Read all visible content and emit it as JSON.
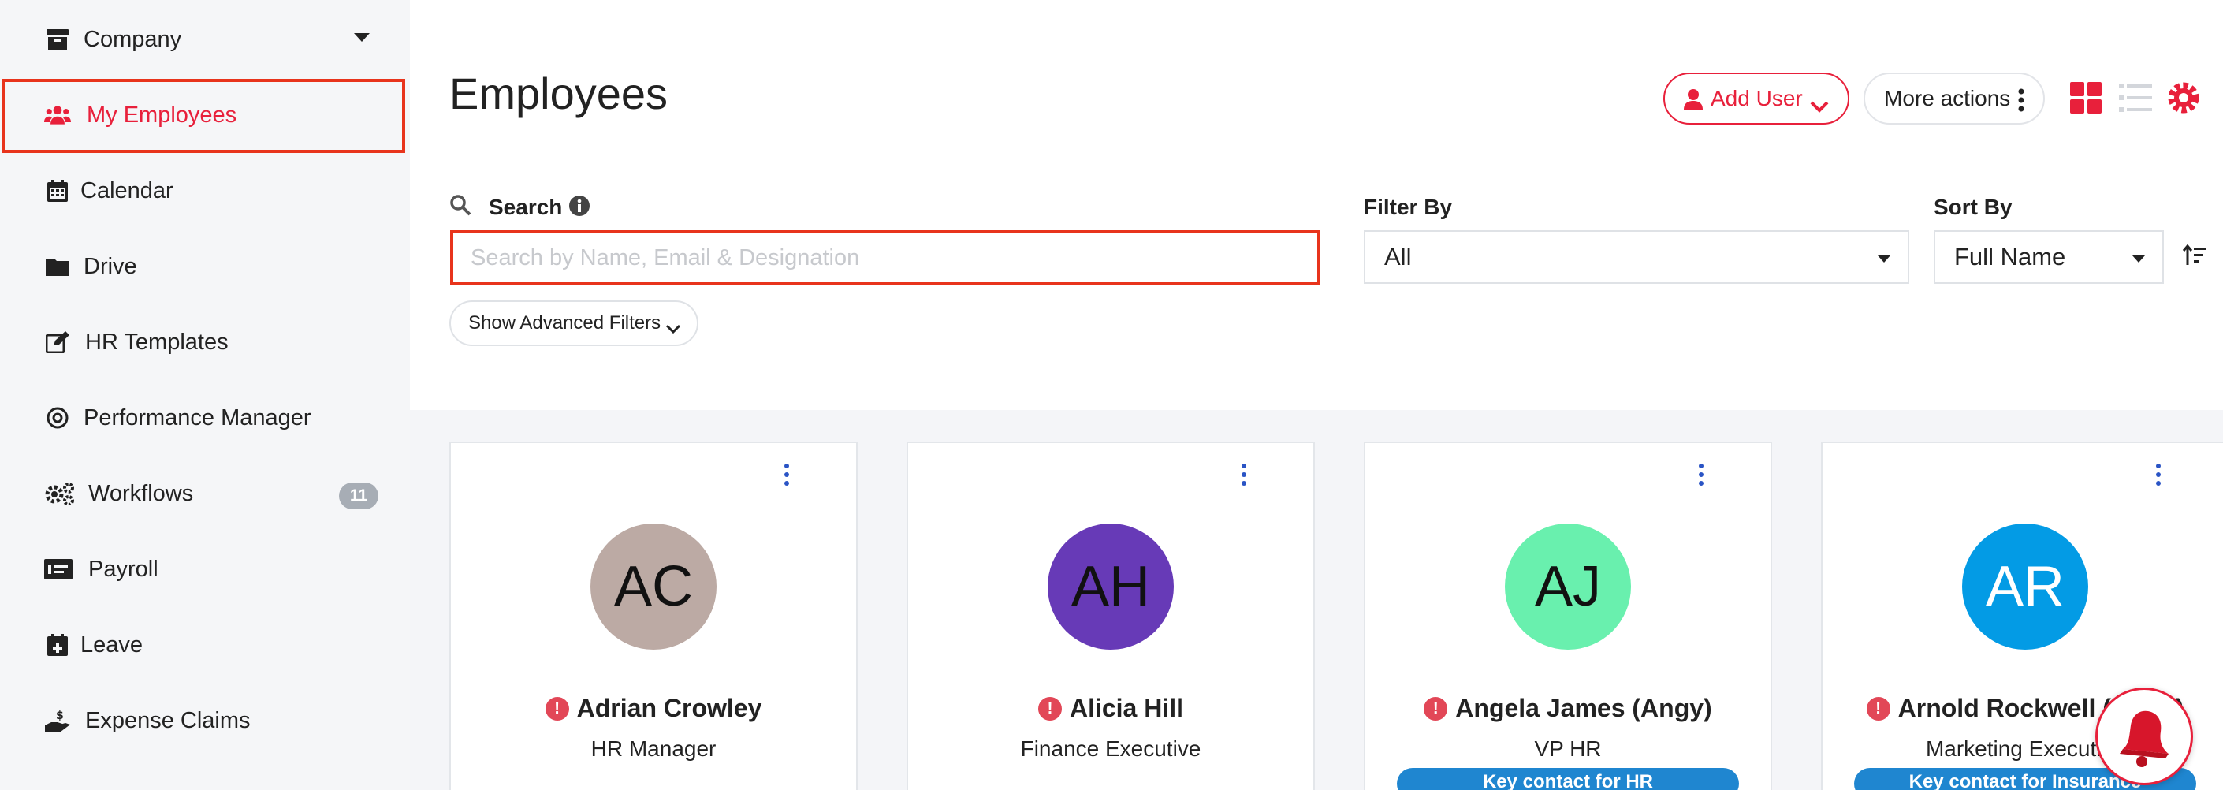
{
  "sidebar": {
    "items": [
      {
        "label": "Company",
        "icon": "archive-icon"
      },
      {
        "label": "My Employees",
        "icon": "users-icon"
      },
      {
        "label": "Calendar",
        "icon": "calendar-icon"
      },
      {
        "label": "Drive",
        "icon": "folder-icon"
      },
      {
        "label": "HR Templates",
        "icon": "edit-icon"
      },
      {
        "label": "Performance Manager",
        "icon": "target-icon"
      },
      {
        "label": "Workflows",
        "icon": "cogs-icon",
        "badge": "11"
      },
      {
        "label": "Payroll",
        "icon": "money-check-icon"
      },
      {
        "label": "Leave",
        "icon": "calendar-plus-icon"
      },
      {
        "label": "Expense Claims",
        "icon": "hand-holding-dollar-icon"
      }
    ]
  },
  "header": {
    "title": "Employees",
    "add_user_label": "Add User",
    "more_actions_label": "More actions"
  },
  "search": {
    "label": "Search",
    "placeholder": "Search by Name, Email & Designation",
    "value": ""
  },
  "filter": {
    "label": "Filter By",
    "value": "All"
  },
  "sort": {
    "label": "Sort By",
    "value": "Full Name"
  },
  "advanced_filters_label": "Show Advanced Filters",
  "employees": [
    {
      "initials": "AC",
      "name": "Adrian Crowley",
      "role": "HR Manager",
      "avatar_bg": "#bcaaa4",
      "key_contact": ""
    },
    {
      "initials": "AH",
      "name": "Alicia Hill",
      "role": "Finance Executive",
      "avatar_bg": "#673ab7",
      "key_contact": ""
    },
    {
      "initials": "AJ",
      "name": "Angela James (Angy)",
      "role": "VP HR",
      "avatar_bg": "#69f0ae",
      "key_contact": "Key contact for HR"
    },
    {
      "initials": "AR",
      "name": "Arnold Rockwell (Arnie)",
      "role": "Marketing Executive",
      "avatar_bg": "#039be5",
      "key_contact": "Key contact for Insurance"
    }
  ],
  "colors": {
    "accent": "#e8203b",
    "highlight_border": "#e8341c",
    "key_contact": "#1f86d0",
    "kebab": "#2a54c5"
  }
}
